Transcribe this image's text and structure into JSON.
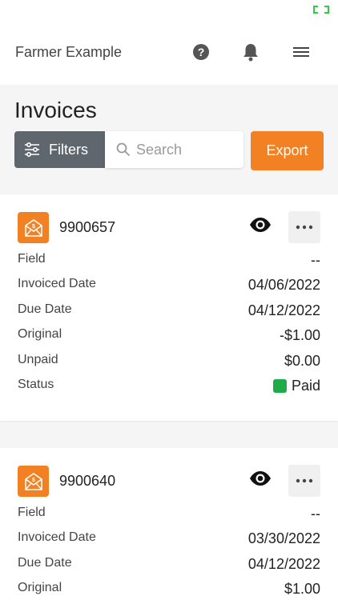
{
  "header": {
    "title": "Farmer Example",
    "icons": [
      "help-icon",
      "bell-icon",
      "menu-icon"
    ]
  },
  "page": {
    "title": "Invoices"
  },
  "toolbar": {
    "filters_label": "Filters",
    "search_placeholder": "Search",
    "search_value": "",
    "export_label": "Export"
  },
  "colors": {
    "accent": "#f28123",
    "filters_bg": "#5f666d",
    "paid": "#1fab47",
    "status_bar_icon": "#2ecc40"
  },
  "invoices": [
    {
      "number": "9900657",
      "rows": [
        {
          "label": "Field",
          "value": "--"
        },
        {
          "label": "Invoiced Date",
          "value": "04/06/2022"
        },
        {
          "label": "Due Date",
          "value": "04/12/2022"
        },
        {
          "label": "Original",
          "value": "-$1.00"
        },
        {
          "label": "Unpaid",
          "value": "$0.00"
        },
        {
          "label": "Status",
          "value": "Paid"
        }
      ]
    },
    {
      "number": "9900640",
      "rows": [
        {
          "label": "Field",
          "value": "--"
        },
        {
          "label": "Invoiced Date",
          "value": "03/30/2022"
        },
        {
          "label": "Due Date",
          "value": "04/12/2022"
        },
        {
          "label": "Original",
          "value": "$1.00"
        }
      ]
    }
  ]
}
